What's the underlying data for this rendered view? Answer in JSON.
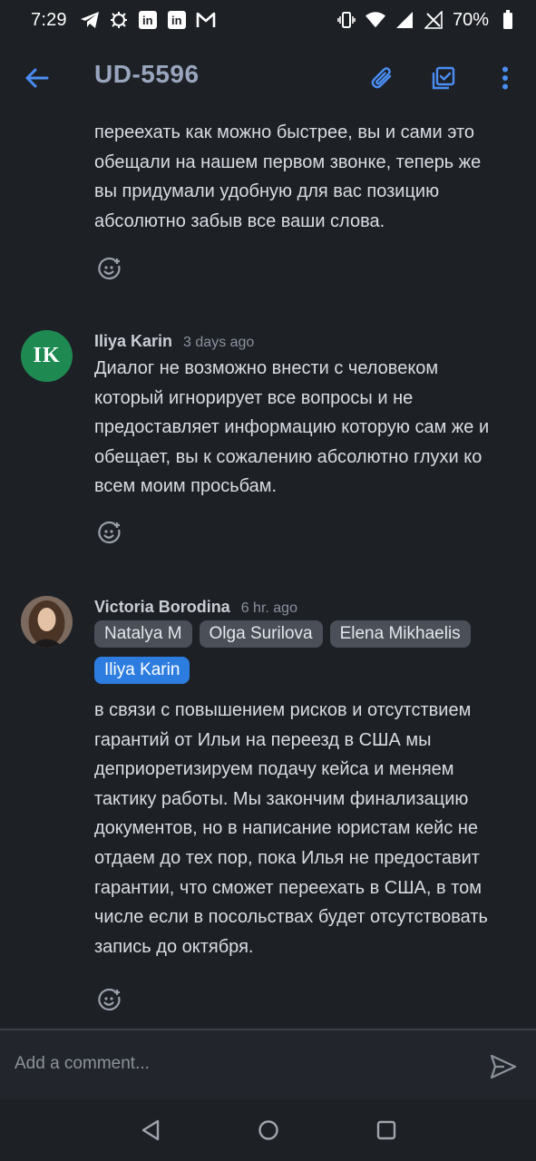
{
  "status_bar": {
    "time": "7:29",
    "battery": "70%",
    "left_icons": [
      "telegram-icon",
      "bug-icon",
      "linkedin-icon",
      "linkedin-icon",
      "gmail-icon"
    ],
    "right_icons": [
      "vibrate-icon",
      "wifi-icon",
      "signal-icon",
      "no-signal-icon",
      "battery-icon"
    ]
  },
  "app_bar": {
    "title": "UD-5596",
    "actions": [
      "attachment-icon",
      "checklist-icon",
      "more-vert-icon"
    ]
  },
  "feed": {
    "partial_comment": {
      "text": "переехать как можно быстрее, вы и сами это\nобещали на нашем первом звонке, теперь же\nвы придумали удобную для вас позицию\nабсолютно забыв все ваши слова."
    },
    "comments": [
      {
        "initials": "IK",
        "author": "Iliya Karin",
        "time": "3 days ago",
        "text": "Диалог не возможно внести с человеком\nкоторый игнорирует все вопросы и не\nпредоставляет информацию которую сам же и\nобещает, вы к сожалению абсолютно глухи ко\nвсем моим просьбам."
      },
      {
        "author": "Victoria Borodina",
        "time": "6 hr. ago",
        "mentions": [
          "Natalya M",
          "Olga Surilova",
          "Elena Mikhaelis",
          "Iliya Karin"
        ],
        "text": "в связи с повышением рисков и отсутствием\nгарантий от Ильи на переезд в США мы\nдеприоретизируем подачу кейса и меняем\nтактику работы. Мы закончим финализацию\nдокументов, но в написание юристам кейс не\nотдаем до тех пор, пока Илья не предоставит\nгарантии, что сможет переехать в США, в том\nчисле если в посольствах будет отсутствовать\nзапись до октября."
      }
    ]
  },
  "comment_bar": {
    "placeholder": "Add a comment..."
  },
  "colors": {
    "background": "#1d2025",
    "accent": "#2d7de0",
    "avatar_green": "#1e8a52",
    "title": "#9aa6bf"
  }
}
